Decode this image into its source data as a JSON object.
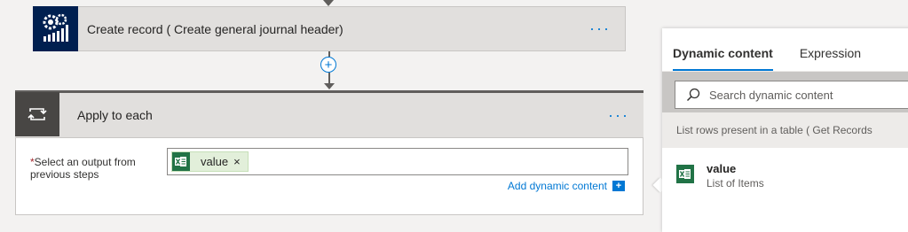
{
  "steps": {
    "create_record": {
      "title": "Create record ( Create general journal header)",
      "more": "···",
      "icon": "dynamics-gears-icon",
      "color": "#002050"
    },
    "insert": {
      "symbol": "+"
    },
    "apply_to_each": {
      "title": "Apply to each",
      "more": "···",
      "icon": "loop-icon",
      "field": {
        "required_mark": "*",
        "label": "Select an output from previous steps",
        "token": {
          "label": "value",
          "close": "×",
          "icon": "excel-icon"
        }
      },
      "add_dynamic": "Add dynamic content"
    }
  },
  "panel": {
    "tabs": [
      {
        "label": "Dynamic content",
        "active": true
      },
      {
        "label": "Expression",
        "active": false
      }
    ],
    "search": {
      "placeholder": "Search dynamic content",
      "icon": "search-icon"
    },
    "section": "List rows present in a table ( Get Records",
    "items": [
      {
        "name": "value",
        "desc": "List of Items",
        "icon": "excel-icon"
      }
    ]
  },
  "colors": {
    "accent": "#0078d4",
    "excel": "#217346",
    "dynamics": "#002050"
  }
}
